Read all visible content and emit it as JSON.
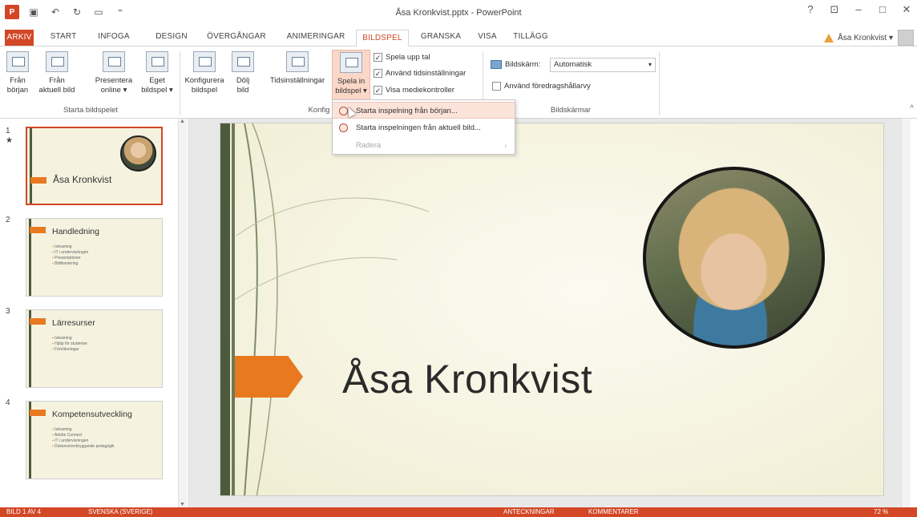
{
  "app": {
    "window_title": "Åsa Kronkvist.pptx - PowerPoint",
    "window_controls": [
      "?",
      "⊡",
      "–",
      "□",
      "✕"
    ]
  },
  "qat": {
    "logo": "P",
    "save_icon": "save-icon",
    "undo_icon": "undo-icon",
    "redo_icon": "redo-icon",
    "start_icon": "present-icon",
    "more_icon": "customize-icon"
  },
  "tabs": [
    {
      "label": "ARKIV"
    },
    {
      "label": "START"
    },
    {
      "label": "INFOGA"
    },
    {
      "label": "DESIGN"
    },
    {
      "label": "ÖVERGÅNGAR"
    },
    {
      "label": "ANIMERINGAR"
    },
    {
      "label": "BILDSPEL"
    },
    {
      "label": "GRANSKA"
    },
    {
      "label": "VISA"
    },
    {
      "label": "TILLÄGG"
    }
  ],
  "user": {
    "name": "Åsa Kronkvist ▾"
  },
  "ribbon": {
    "start": {
      "from_start": "Från\nbörjan",
      "from_current": "Från\naktuell bild",
      "present_online": "Presentera\nonline ▾",
      "custom_show": "Eget\nbildspel ▾",
      "group_label": "Starta bildspelet"
    },
    "setup": {
      "configure": "Konfigurera\nbildspel",
      "hide": "Dölj\nbild",
      "timings": "Tidsinställningar",
      "record": "Spela in\nbildspel ▾",
      "group_label": "Konfig",
      "play_narrations": "Spela upp tal",
      "use_timings": "Använd tidsinställningar",
      "show_media_controls": "Visa mediekontroller"
    },
    "monitors": {
      "monitor_label": "Bildskärm:",
      "monitor_value": "Automatisk",
      "presenter_view": "Använd föredragshållarvy",
      "group_label": "Bildskärmar"
    }
  },
  "dropdown": {
    "items": [
      {
        "label": "Starta inspelning från början..."
      },
      {
        "label": "Starta inspelningen från aktuell bild..."
      },
      {
        "label": "Radera"
      }
    ]
  },
  "thumbnails": [
    {
      "num": "1",
      "star": "★",
      "title": "Åsa Kronkvist",
      "bullets": []
    },
    {
      "num": "2",
      "title": "Handledning",
      "bullets": [
        "Isleaming",
        "IT i undervisningen",
        "Presentationer",
        "Bildhantering"
      ]
    },
    {
      "num": "3",
      "title": "Lärresurser",
      "bullets": [
        "Isleaming",
        "Hjälp för studenter",
        "Föreläsningar"
      ]
    },
    {
      "num": "4",
      "title": "Kompetensutveckling",
      "bullets": [
        "Isleaming",
        "Adobe Connect",
        "IT i undervisningen",
        "Distansöverbryggande pedagogik"
      ]
    }
  ],
  "slide": {
    "title": "Åsa Kronkvist",
    "accent_color": "#e8791f",
    "bar_color": "#4e5a3e"
  },
  "colors": {
    "brand": "#d24726",
    "ribbon_highlight": "#fbd7c8"
  },
  "statusbar": {
    "slide_info": "BILD 1 AV 4",
    "language": "SVENSKA (SVERIGE)",
    "notes": "ANTECKNINGAR",
    "comments": "KOMMENTARER",
    "zoom": "72 %"
  }
}
